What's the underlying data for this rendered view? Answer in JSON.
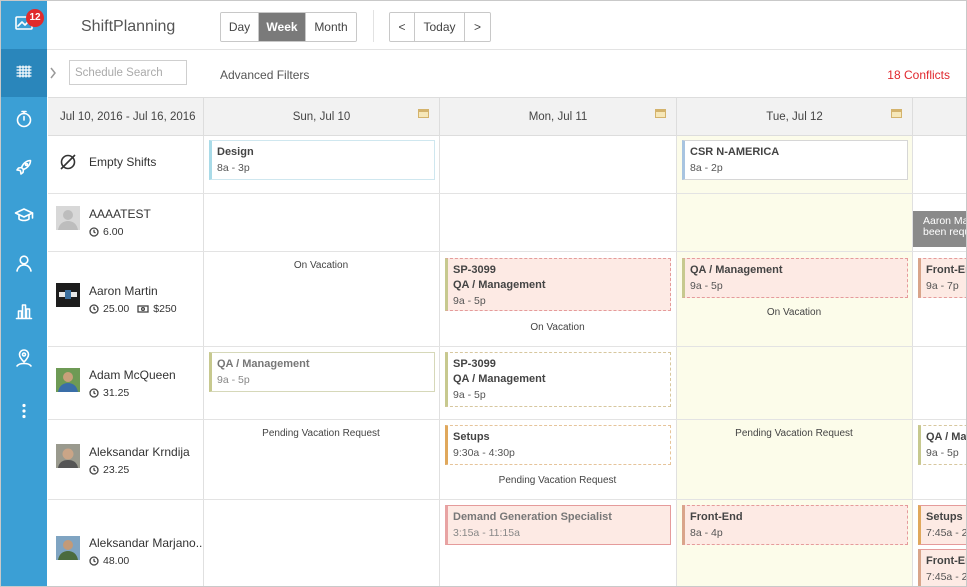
{
  "rail": {
    "notification_count": "12"
  },
  "header": {
    "brand": "ShiftPlanning",
    "views": [
      "Day",
      "Week",
      "Month"
    ],
    "active_view": "Week",
    "nav_prev": "<",
    "nav_today": "Today",
    "nav_next": ">"
  },
  "filters": {
    "search_placeholder": "Schedule Search",
    "advanced_label": "Advanced Filters",
    "conflicts": "18 Conflicts"
  },
  "schedule": {
    "range": "Jul 10, 2016 - Jul 16, 2016",
    "days": [
      "Sun, Jul 10",
      "Mon, Jul 11",
      "Tue, Jul 12"
    ],
    "today_index": 2,
    "rows": [
      {
        "name": "Empty Shifts"
      },
      {
        "name": "AAAATEST",
        "hours": "6.00"
      },
      {
        "name": "Aaron Martin",
        "hours": "25.00",
        "pay": "$250"
      },
      {
        "name": "Adam McQueen",
        "hours": "31.25"
      },
      {
        "name": "Aleksandar Krndija",
        "hours": "23.25"
      },
      {
        "name": "Aleksandar Marjano..",
        "hours": "48.00"
      }
    ],
    "shifts": {
      "design": {
        "title": "Design",
        "time": "8a - 3p",
        "color": "#a9dbe8"
      },
      "csr": {
        "title": "CSR N-AMERICA",
        "time": "8a - 2p",
        "color": "#a8c4e0"
      },
      "am_mon": {
        "line1": "SP-3099",
        "line2": "QA / Management",
        "time": "9a - 5p",
        "color": "#c7c98f"
      },
      "am_tue": {
        "title": "QA / Management",
        "time": "9a - 5p",
        "color": "#c7c98f"
      },
      "am_wed": {
        "title": "Front-End",
        "time": "9a - 7p",
        "color": "#d9a58a"
      },
      "mq_sun": {
        "title": "QA / Management",
        "time": "9a - 5p",
        "color": "#c7c98f"
      },
      "mq_mon": {
        "line1": "SP-3099",
        "line2": "QA / Management",
        "time": "9a - 5p",
        "color": "#c7c98f"
      },
      "ak_mon": {
        "title": "Setups",
        "time": "9:30a - 4:30p",
        "color": "#e0a85c"
      },
      "ak_wed": {
        "title": "QA / Mar",
        "time": "9a - 5p",
        "color": "#c7c98f"
      },
      "amj_mon": {
        "title": "Demand Generation Specialist",
        "time": "3:15a - 11:15a",
        "color": "#e8a3a3"
      },
      "amj_tue": {
        "title": "Front-End",
        "time": "8a - 4p",
        "color": "#d9a58a"
      },
      "amj_wed1": {
        "title": "Setups",
        "time": "7:45a - 2",
        "color": "#e0a85c"
      },
      "amj_wed2": {
        "title": "Front-En",
        "time": "7:45a - 2",
        "color": "#d9a58a"
      }
    },
    "notes": {
      "on_vacation": "On Vacation",
      "pending_vacation": "Pending Vacation Request"
    },
    "tooltip": {
      "line1": "Aaron Ma",
      "line2": "been requ"
    }
  },
  "colors": {
    "rail": "#3b9fd5",
    "rail_active": "#2a86bb",
    "conflict": "#e0282e",
    "conflict_shift_bg": "#fdeae4",
    "today_bg": "#fcfcea"
  }
}
